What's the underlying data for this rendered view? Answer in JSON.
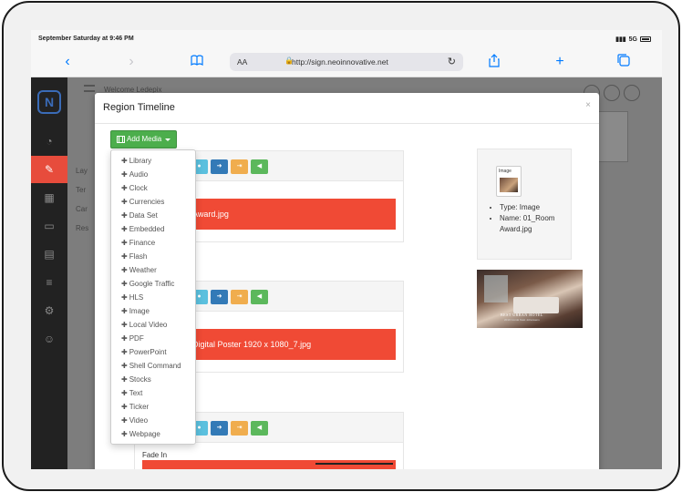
{
  "status": {
    "time": "September Saturday at 9:46 PM",
    "signal": "5G"
  },
  "browser": {
    "aa": "AA",
    "url": "http://sign.neoinnovative.net"
  },
  "background": {
    "breadcrumb": "Welcome Ledepix",
    "sidebar_labels": [
      "Lay",
      "Ter",
      "Car",
      "Res"
    ]
  },
  "modal": {
    "title": "Region Timeline",
    "close": "×",
    "add_media": "Add Media",
    "menu": [
      "Library",
      "Audio",
      "Clock",
      "Currencies",
      "Data Set",
      "Embedded",
      "Finance",
      "Flash",
      "Weather",
      "Google Traffic",
      "HLS",
      "Image",
      "Local Video",
      "PDF",
      "PowerPoint",
      "Shell Command",
      "Stocks",
      "Text",
      "Ticker",
      "Video",
      "Webpage"
    ],
    "items": [
      {
        "label": "Award.jpg"
      },
      {
        "label": "Digital Poster 1920 x 1080_7.jpg"
      },
      {
        "fade": "Fade In"
      }
    ],
    "info": {
      "thumb_label": "Image",
      "type": "Type: Image",
      "name": "Name: 01_Room Award.jpg"
    },
    "preview_caption": "BEST URBAN HOTEL",
    "preview_subcaption": "2019 Condé Nast Johansens"
  }
}
